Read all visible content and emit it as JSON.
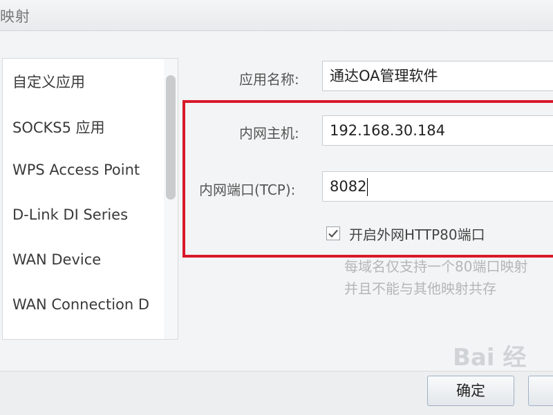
{
  "window": {
    "title": "映射"
  },
  "app_list": {
    "items": [
      "自定义应用",
      "SOCKS5 应用",
      "WPS Access Point",
      "D-Link DI Series",
      "WAN Device",
      "WAN Connection D"
    ]
  },
  "form": {
    "app_name_label": "应用名称:",
    "app_name_value": "通达OA管理软件",
    "host_label": "内网主机:",
    "host_value": "192.168.30.184",
    "port_label": "内网端口(TCP):",
    "port_value": "8082",
    "http80_label": "开启外网HTTP80端口",
    "http80_checked": true,
    "hint_line1": "每域名仅支持一个80端口映射",
    "hint_line2": "并且不能与其他映射共存"
  },
  "buttons": {
    "confirm": "确定"
  },
  "watermark": {
    "text": "Bai 经"
  },
  "colors": {
    "highlight": "#d8182a"
  }
}
